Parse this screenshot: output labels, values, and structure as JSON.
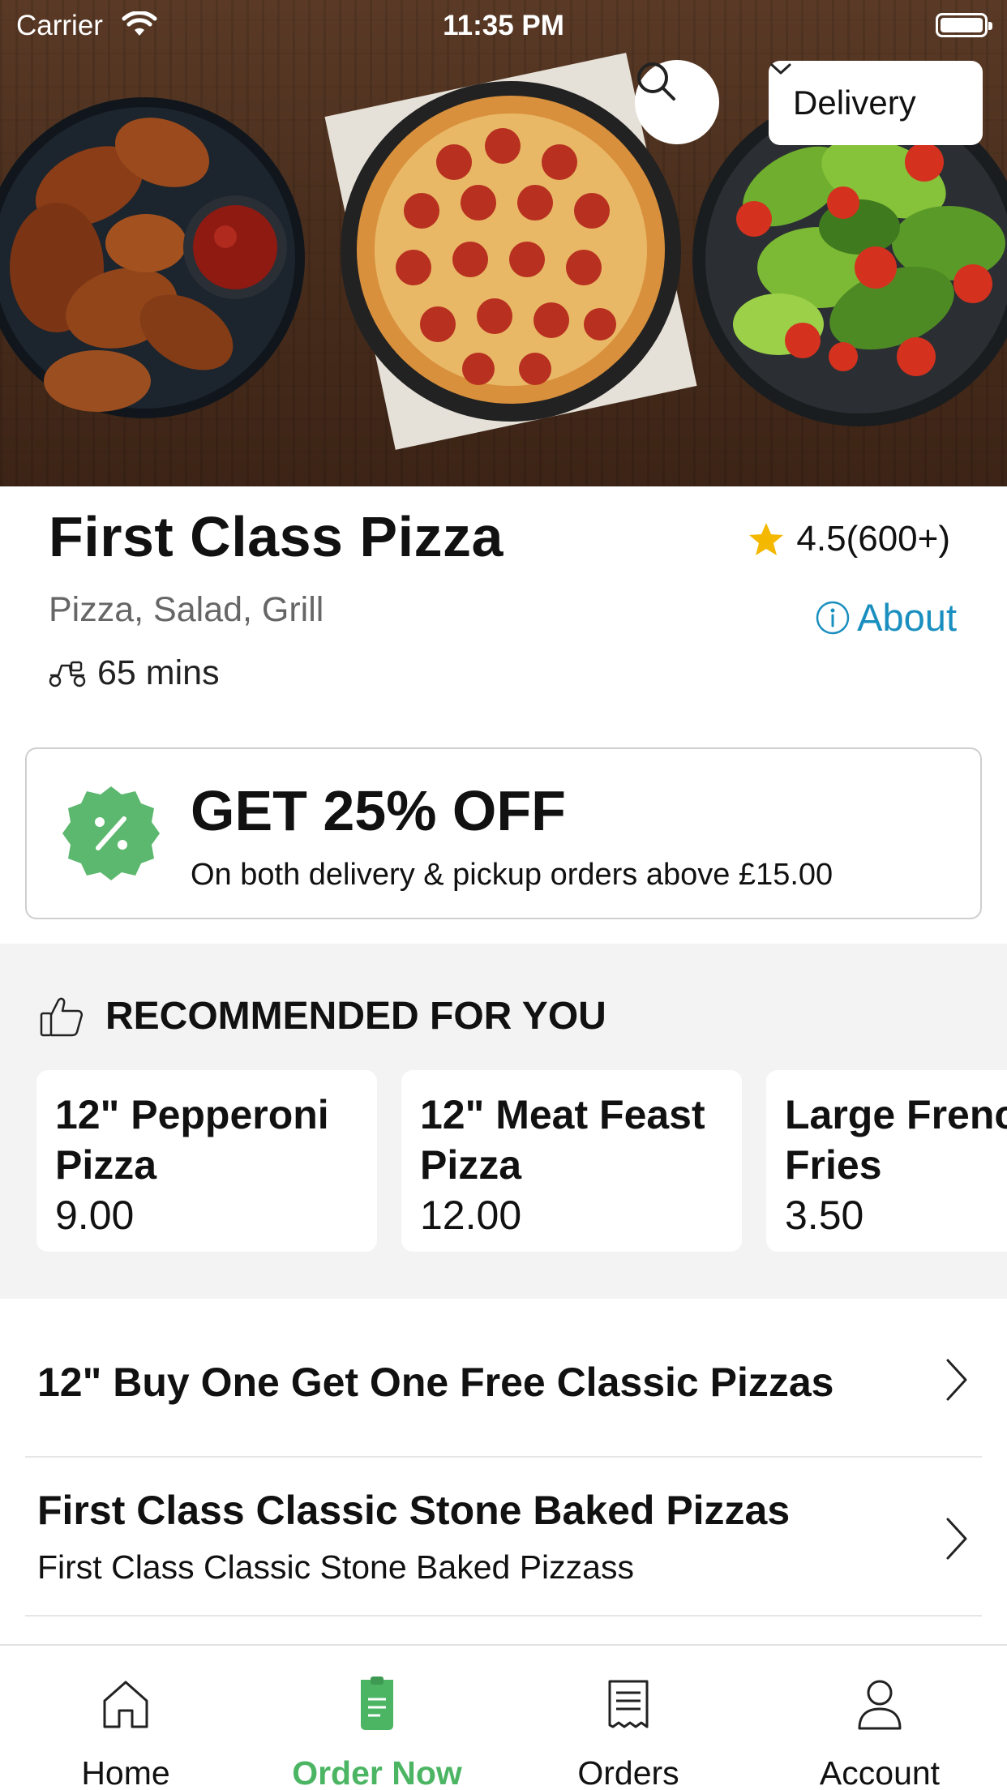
{
  "status_bar": {
    "carrier": "Carrier",
    "time": "11:35 PM"
  },
  "header": {
    "search_icon": "search-icon",
    "order_mode": "Delivery"
  },
  "restaurant": {
    "name": "First Class Pizza",
    "rating": "4.5(600+)",
    "cuisines": "Pizza, Salad, Grill",
    "about_label": "About",
    "delivery_time": "65 mins"
  },
  "offer": {
    "title": "GET 25% OFF",
    "subtitle": "On both delivery & pickup orders above £15.00"
  },
  "recommended": {
    "title": "RECOMMENDED FOR YOU",
    "items": [
      {
        "name": "12\" Pepperoni Pizza",
        "price": "9.00"
      },
      {
        "name": "12\" Meat Feast Pizza",
        "price": "12.00"
      },
      {
        "name": "Large French Fries",
        "price": "3.50"
      }
    ]
  },
  "categories": [
    {
      "title": "12\" Buy One Get One Free Classic Pizzas",
      "subtitle": ""
    },
    {
      "title": "First Class Classic Stone Baked Pizzas",
      "subtitle": "First Class Classic Stone Baked Pizzass"
    }
  ],
  "tabs": [
    {
      "label": "Home",
      "icon": "home-icon",
      "active": false
    },
    {
      "label": "Order Now",
      "icon": "order-now-icon",
      "active": true
    },
    {
      "label": "Orders",
      "icon": "receipt-icon",
      "active": false
    },
    {
      "label": "Account",
      "icon": "user-icon",
      "active": false
    }
  ],
  "colors": {
    "accent_green": "#4cb563",
    "link_blue": "#1a8fbf",
    "star_yellow": "#f5b800",
    "offer_badge_green": "#5cb86e"
  }
}
